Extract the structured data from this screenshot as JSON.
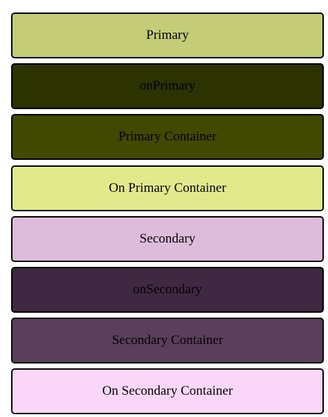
{
  "swatches": [
    {
      "label": "Primary",
      "color": "#c4cc78"
    },
    {
      "label": "onPrimary",
      "color": "#2c3200"
    },
    {
      "label": "Primary Container",
      "color": "#414800"
    },
    {
      "label": "On Primary Container",
      "color": "#e1e98a"
    },
    {
      "label": "Secondary",
      "color": "#ddbbdb"
    },
    {
      "label": "onSecondary",
      "color": "#412842"
    },
    {
      "label": "Secondary Container",
      "color": "#5a3e5b"
    },
    {
      "label": "On Secondary Container",
      "color": "#fad6f8"
    }
  ]
}
